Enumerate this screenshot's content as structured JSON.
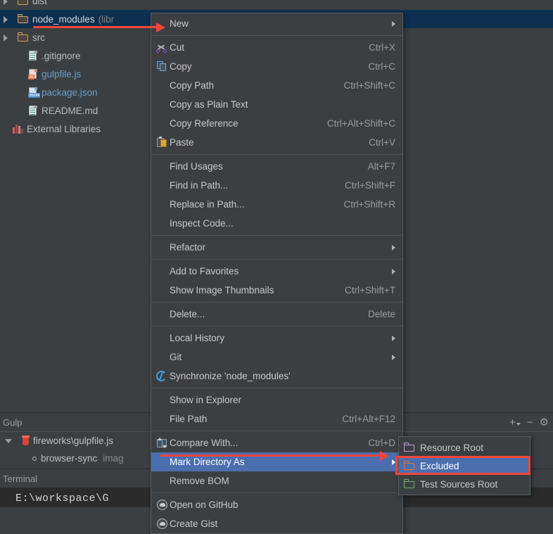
{
  "project_tree": {
    "rows": [
      {
        "indent": 0,
        "twisty": "collapsed",
        "icon": "folder-icon",
        "label": "dist",
        "suffix": "",
        "style": "plain",
        "selected": false,
        "clipped_top": true
      },
      {
        "indent": 0,
        "twisty": "collapsed",
        "icon": "folder-icon",
        "label": "node_modules",
        "suffix": "(libr",
        "style": "plain",
        "selected": true
      },
      {
        "indent": 0,
        "twisty": "collapsed",
        "icon": "folder-icon",
        "label": "src",
        "suffix": "",
        "style": "plain",
        "selected": false
      },
      {
        "indent": 1,
        "twisty": "none",
        "icon": "file-icon",
        "label": ".gitignore",
        "suffix": "",
        "style": "plain",
        "selected": false
      },
      {
        "indent": 1,
        "twisty": "none",
        "icon": "js-file-icon",
        "label": "gulpfile.js",
        "suffix": "",
        "style": "vcs",
        "selected": false
      },
      {
        "indent": 1,
        "twisty": "none",
        "icon": "json-file-icon",
        "label": "package.json",
        "suffix": "",
        "style": "vcs",
        "selected": false
      },
      {
        "indent": 1,
        "twisty": "none",
        "icon": "file-icon",
        "label": "README.md",
        "suffix": "",
        "style": "plain",
        "selected": false
      },
      {
        "indent": 0,
        "twisty": "none",
        "icon": "external-libraries-icon",
        "label": "External Libraries",
        "suffix": "",
        "style": "plain",
        "selected": false
      }
    ]
  },
  "context_menu": {
    "items": [
      {
        "label": "New",
        "accel": "",
        "icon": "",
        "submenu": true,
        "separator_after": true
      },
      {
        "label": "Cut",
        "accel": "Ctrl+X",
        "icon": "scissors-icon",
        "submenu": false
      },
      {
        "label": "Copy",
        "accel": "Ctrl+C",
        "icon": "copy-icon",
        "submenu": false
      },
      {
        "label": "Copy Path",
        "accel": "Ctrl+Shift+C",
        "icon": "",
        "submenu": false
      },
      {
        "label": "Copy as Plain Text",
        "accel": "",
        "icon": "",
        "submenu": false
      },
      {
        "label": "Copy Reference",
        "accel": "Ctrl+Alt+Shift+C",
        "icon": "",
        "submenu": false
      },
      {
        "label": "Paste",
        "accel": "Ctrl+V",
        "icon": "paste-icon",
        "submenu": false,
        "separator_after": true
      },
      {
        "label": "Find Usages",
        "accel": "Alt+F7",
        "icon": "",
        "submenu": false
      },
      {
        "label": "Find in Path...",
        "accel": "Ctrl+Shift+F",
        "icon": "",
        "submenu": false
      },
      {
        "label": "Replace in Path...",
        "accel": "Ctrl+Shift+R",
        "icon": "",
        "submenu": false
      },
      {
        "label": "Inspect Code...",
        "accel": "",
        "icon": "",
        "submenu": false,
        "separator_after": true
      },
      {
        "label": "Refactor",
        "accel": "",
        "icon": "",
        "submenu": true,
        "separator_after": true
      },
      {
        "label": "Add to Favorites",
        "accel": "",
        "icon": "",
        "submenu": true
      },
      {
        "label": "Show Image Thumbnails",
        "accel": "Ctrl+Shift+T",
        "icon": "",
        "submenu": false,
        "separator_after": true
      },
      {
        "label": "Delete...",
        "accel": "Delete",
        "icon": "",
        "submenu": false,
        "separator_after": true
      },
      {
        "label": "Local History",
        "accel": "",
        "icon": "",
        "submenu": true
      },
      {
        "label": "Git",
        "accel": "",
        "icon": "",
        "submenu": true
      },
      {
        "label": "Synchronize 'node_modules'",
        "accel": "",
        "icon": "sync-icon",
        "submenu": false,
        "separator_after": true
      },
      {
        "label": "Show in Explorer",
        "accel": "",
        "icon": "",
        "submenu": false
      },
      {
        "label": "File Path",
        "accel": "Ctrl+Alt+F12",
        "icon": "",
        "submenu": false,
        "separator_after": true
      },
      {
        "label": "Compare With...",
        "accel": "Ctrl+D",
        "icon": "compare-icon",
        "submenu": false
      },
      {
        "label": "Mark Directory As",
        "accel": "",
        "icon": "",
        "submenu": true,
        "highlight": true
      },
      {
        "label": "Remove BOM",
        "accel": "",
        "icon": "",
        "submenu": false,
        "separator_after": true
      },
      {
        "label": "Open on GitHub",
        "accel": "",
        "icon": "github-icon",
        "submenu": false
      },
      {
        "label": "Create Gist",
        "accel": "",
        "icon": "github-icon",
        "submenu": false
      }
    ]
  },
  "submenu": {
    "items": [
      {
        "label": "Resource Root",
        "folder_color": "#c49ad6",
        "highlight": false
      },
      {
        "label": "Excluded",
        "folder_color": "#e0703a",
        "highlight": true
      },
      {
        "label": "Test Sources Root",
        "folder_color": "#63b562",
        "highlight": false
      }
    ]
  },
  "gulp_panel": {
    "title": "Gulp",
    "actions": [
      {
        "name": "add-with-dropdown",
        "glyph": "+"
      },
      {
        "name": "remove",
        "glyph": "−"
      },
      {
        "name": "settings",
        "glyph": "⚙"
      }
    ],
    "rows": [
      {
        "twisty": "expanded",
        "icon": "gulp-icon",
        "label": "fireworks\\gulpfile.js",
        "dim": ""
      },
      {
        "twisty": "none",
        "icon": "task-dot-icon",
        "label": "browser-sync",
        "dim": "imag"
      }
    ]
  },
  "terminal_panel": {
    "title": "Terminal",
    "prompt": "E:\\workspace\\G"
  },
  "annotations": {
    "arrow_tree": {
      "name": "red-arrow-to-node-modules"
    },
    "arrow_mark_dir": {
      "name": "red-arrow-to-mark-directory-as"
    },
    "box_excluded": {
      "name": "red-box-around-excluded"
    }
  },
  "colors": {
    "selection_tree": "#0d3050",
    "menu_highlight": "#4b6eaf",
    "annotation_red": "#f4463c",
    "panel_bg": "#3c3f41"
  }
}
